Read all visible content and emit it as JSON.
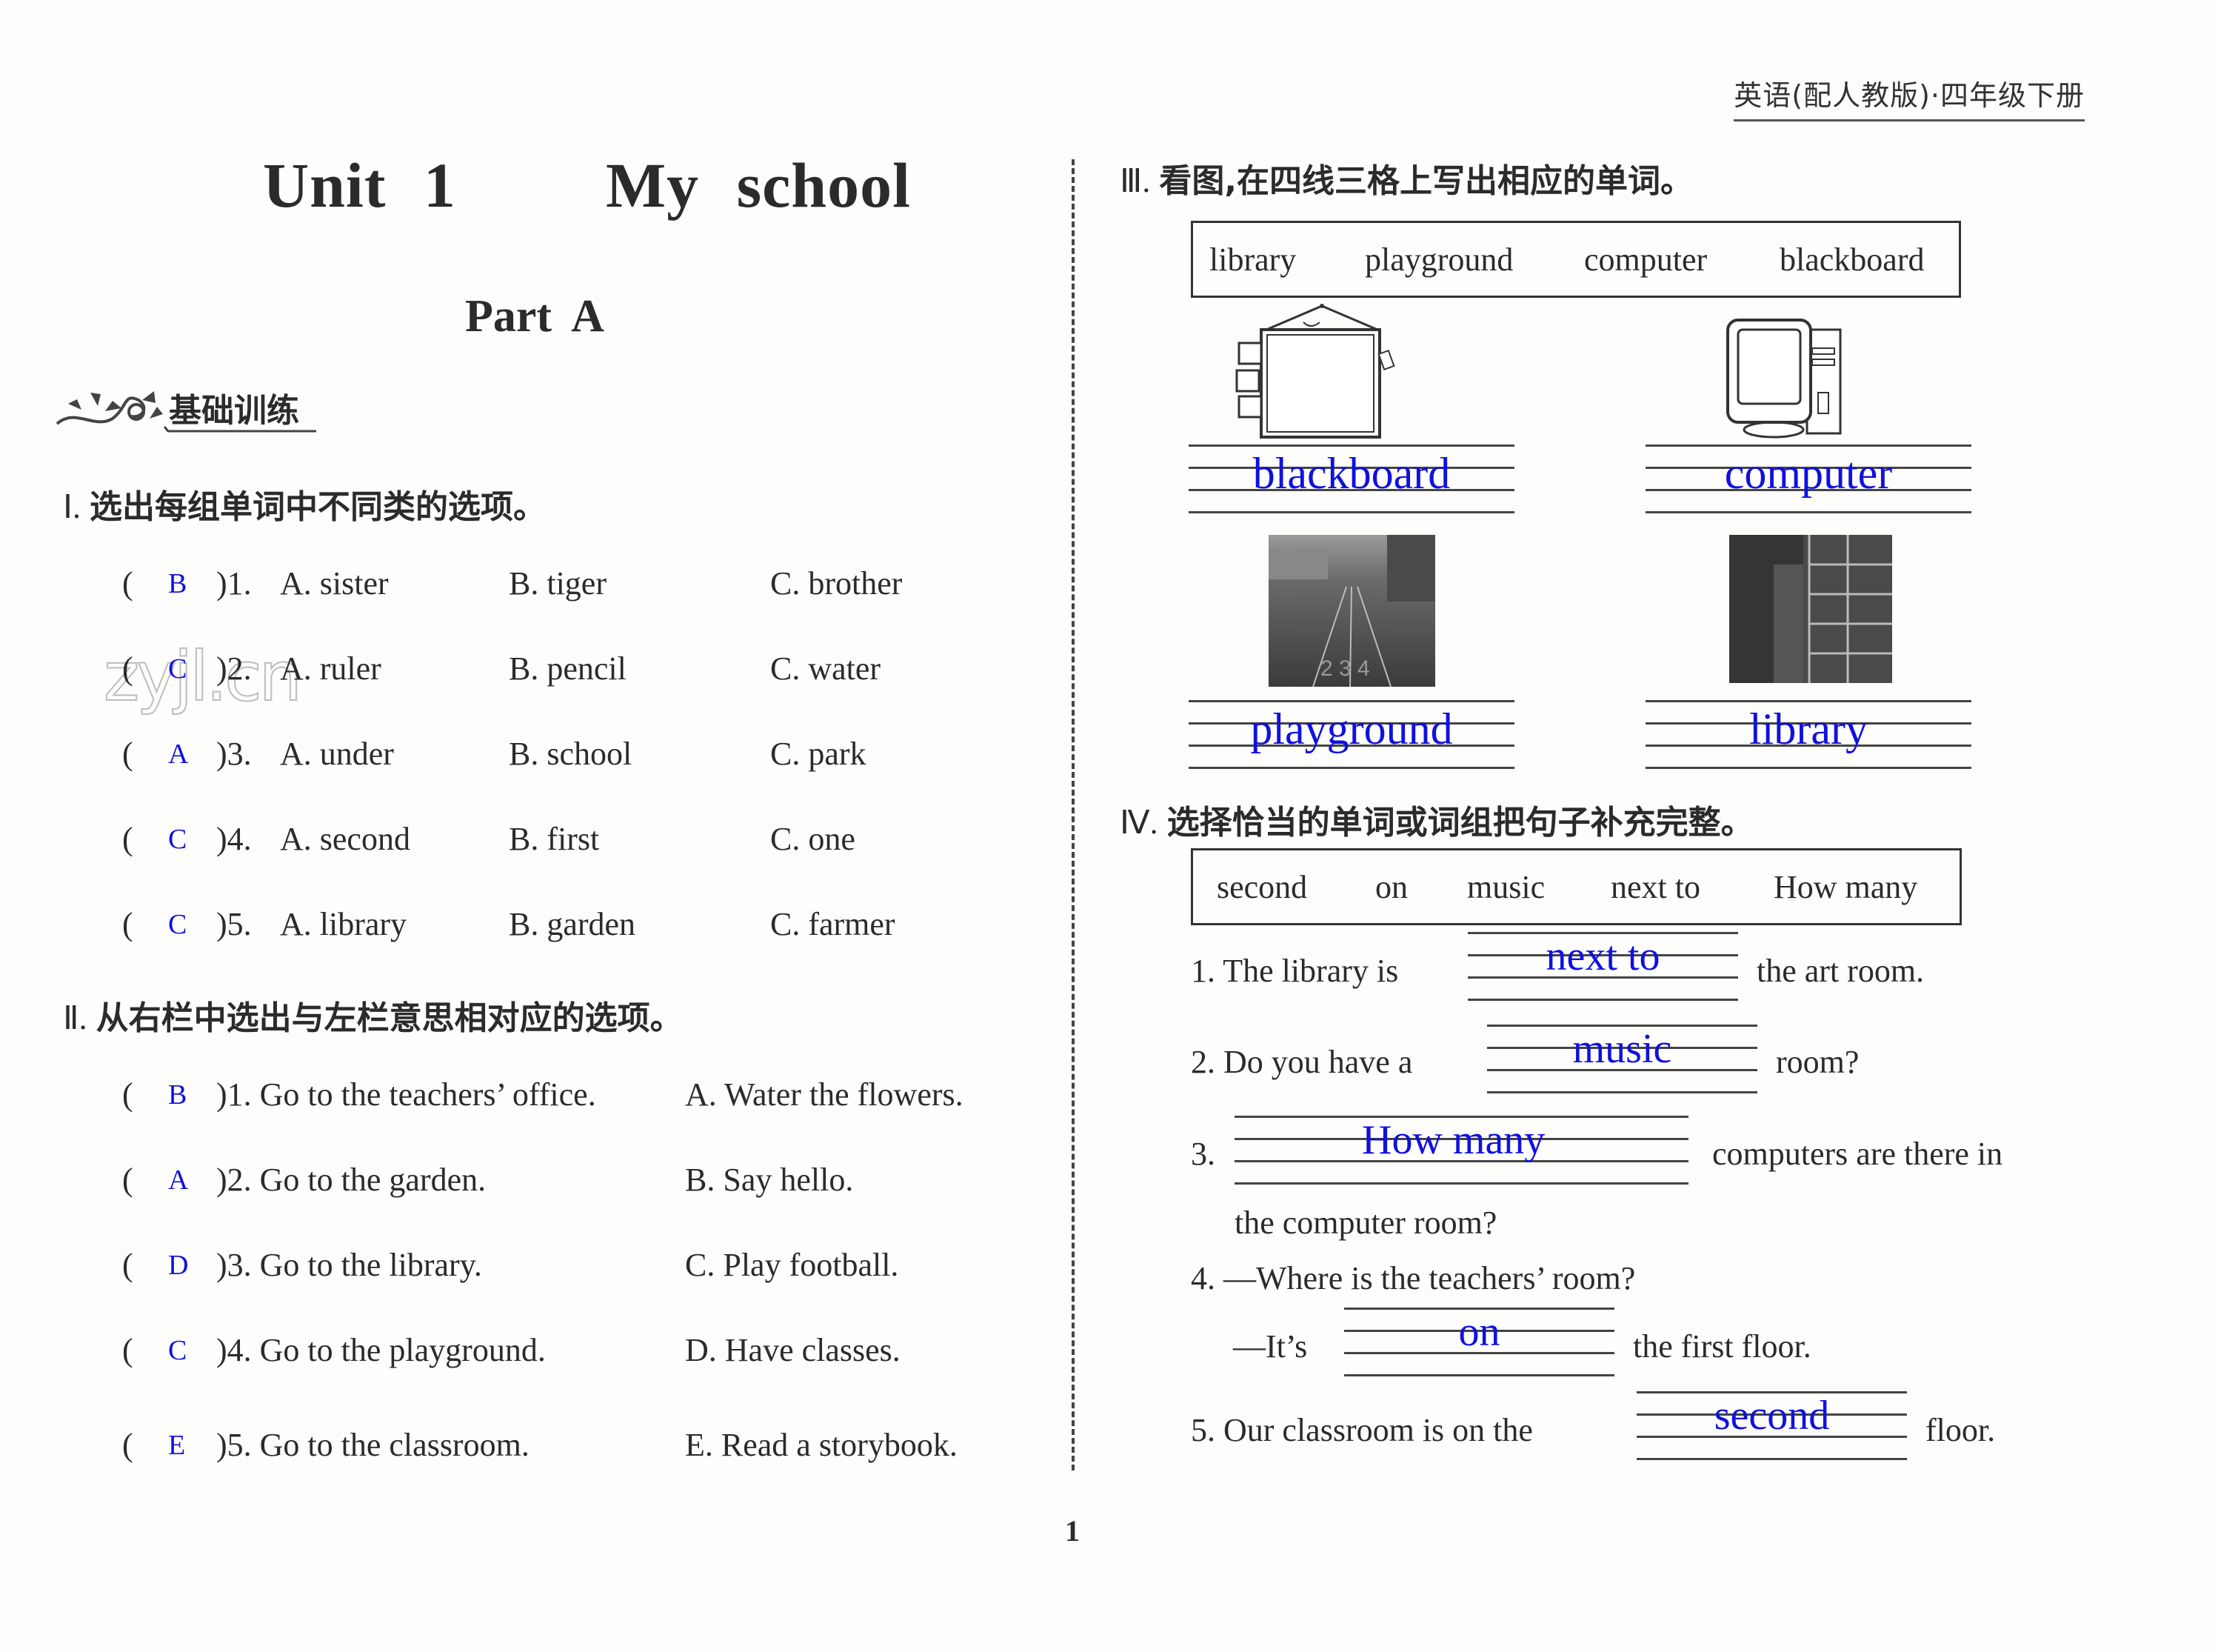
{
  "header": {
    "book_title": "英语(配人教版)·四年级下册"
  },
  "title": {
    "unit": "Unit 1",
    "unit_name": "My school",
    "part": "Part A"
  },
  "banner": {
    "label": "基础训练",
    "icon": "floral-ornament-icon"
  },
  "watermark": "zyjl.cn",
  "section1": {
    "number": "Ⅰ.",
    "instruction": "选出每组单词中不同类的选项。",
    "questions": [
      {
        "answer": "B",
        "num": ")1.",
        "a": "A.  sister",
        "b": "B.  tiger",
        "c": "C.  brother"
      },
      {
        "answer": "C",
        "num": ")2.",
        "a": "A.  ruler",
        "b": "B.  pencil",
        "c": "C.  water"
      },
      {
        "answer": "A",
        "num": ")3.",
        "a": "A.  under",
        "b": "B.  school",
        "c": "C.  park"
      },
      {
        "answer": "C",
        "num": ")4.",
        "a": "A.  second",
        "b": "B.  first",
        "c": "C.  one"
      },
      {
        "answer": "C",
        "num": ")5.",
        "a": "A.  library",
        "b": "B.  garden",
        "c": "C.  farmer"
      }
    ]
  },
  "section2": {
    "number": "Ⅱ.",
    "instruction": "从右栏中选出与左栏意思相对应的选项。",
    "questions": [
      {
        "answer": "B",
        "left": ")1. Go to the teachers’ office.",
        "right": "A.  Water  the  flowers."
      },
      {
        "answer": "A",
        "left": ")2.  Go  to  the  garden.",
        "right": "B.  Say  hello."
      },
      {
        "answer": "D",
        "left": ")3.  Go  to  the  library.",
        "right": "C.  Play  football."
      },
      {
        "answer": "C",
        "left": ")4.  Go  to  the  playground.",
        "right": "D.  Have  classes."
      },
      {
        "answer": "E",
        "left": ")5.  Go  to  the  classroom.",
        "right": "E.  Read  a  storybook."
      }
    ]
  },
  "section3": {
    "number": "Ⅲ.",
    "instruction": "看图,在四线三格上写出相应的单词。",
    "word_bank": [
      "library",
      "playground",
      "computer",
      "blackboard"
    ],
    "pictures": [
      {
        "image": "blackboard-illustration",
        "answer": "blackboard"
      },
      {
        "image": "computer-illustration",
        "answer": "computer"
      },
      {
        "image": "playground-photo",
        "answer": "playground"
      },
      {
        "image": "library-photo",
        "answer": "library"
      }
    ]
  },
  "section4": {
    "number": "Ⅳ.",
    "instruction": "选择恰当的单词或词组把句子补充完整。",
    "word_bank": [
      "second",
      "on",
      "music",
      "next  to",
      "How  many"
    ],
    "sentences": [
      {
        "before": "1.  The  library  is",
        "answer": "next to",
        "after": "the  art  room."
      },
      {
        "before": "2.  Do  you  have  a",
        "answer": "music",
        "after": "room?"
      },
      {
        "before": "3.",
        "answer": "How many",
        "after": "computers  are  there  in",
        "continuation": "the  computer  room?"
      },
      {
        "question": "4.  —Where  is  the  teachers’  room?",
        "before": "—It’s",
        "answer": "on",
        "after": "the  first  floor."
      },
      {
        "before": "5.  Our  classroom  is  on  the",
        "answer": "second",
        "after": "floor."
      }
    ]
  },
  "page_number": "1",
  "colors": {
    "answer": "#1010e0",
    "ink": "#2b2b2b"
  }
}
